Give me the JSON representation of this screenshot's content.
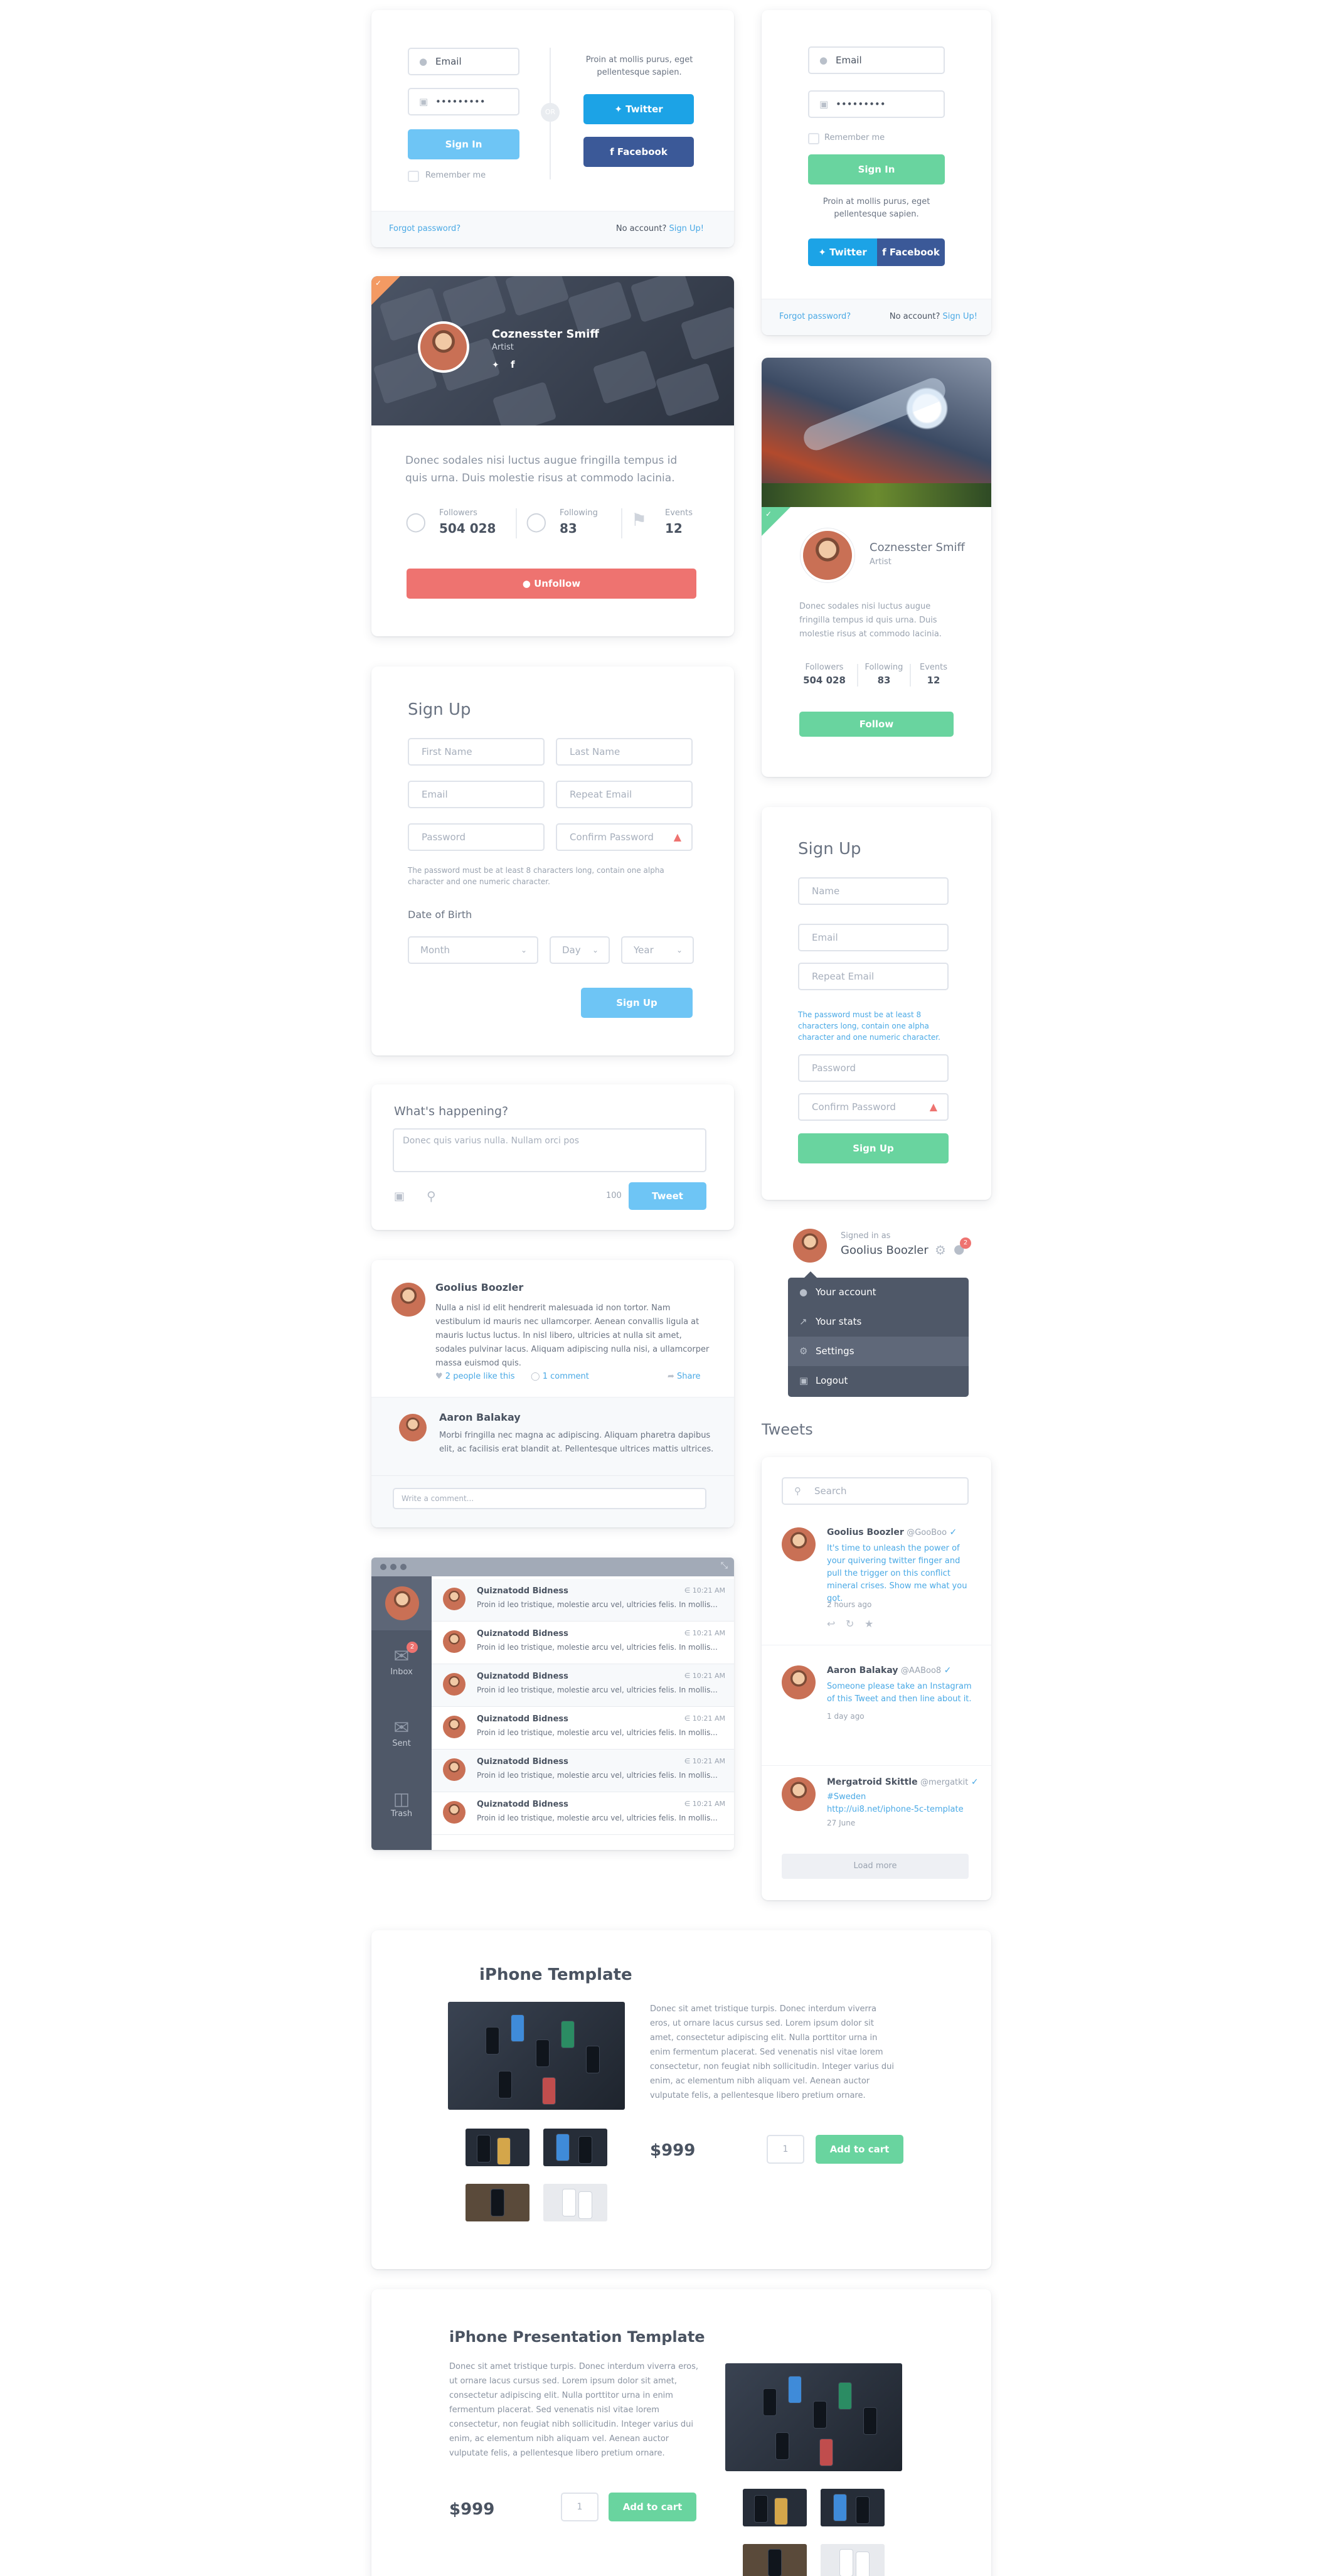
{
  "colors": {
    "accent_blue": "#6ec5f5",
    "accent_green": "#69d49f",
    "danger": "#ee7370",
    "twitter": "#1ca3e6",
    "facebook": "#3b5998",
    "dark_panel": "#4f5868"
  },
  "login1": {
    "email": "Email",
    "password": "•••••••••",
    "sign_in": "Sign In",
    "remember": "Remember me",
    "or": "OR",
    "promo": "Proin at mollis purus, eget pellentesque sapien.",
    "twitter": "Twitter",
    "facebook": "Facebook",
    "forgot": "Forgot password?",
    "no_account": "No account?",
    "sign_up": "Sign Up!"
  },
  "login2": {
    "email": "Email",
    "password": "•••••••••",
    "remember": "Remember me",
    "sign_in": "Sign In",
    "promo": "Proin at mollis purus, eget pellentesque sapien.",
    "twitter": "Twitter",
    "facebook": "Facebook",
    "forgot": "Forgot password?",
    "no_account": "No account?",
    "sign_up": "Sign Up!"
  },
  "profile1": {
    "name": "Coznesster Smiff",
    "role": "Artist",
    "bio": "Donec sodales nisi luctus augue fringilla tempus id quis urna. Duis molestie risus at commodo lacinia.",
    "stats": [
      {
        "label": "Followers",
        "value": "504 028"
      },
      {
        "label": "Following",
        "value": "83"
      },
      {
        "label": "Events",
        "value": "12"
      }
    ],
    "button": "Unfollow"
  },
  "profile2": {
    "name": "Coznesster Smiff",
    "role": "Artist",
    "bio": "Donec sodales nisi luctus augue fringilla tempus id quis urna. Duis molestie risus at commodo lacinia.",
    "stats": [
      {
        "label": "Followers",
        "value": "504 028"
      },
      {
        "label": "Following",
        "value": "83"
      },
      {
        "label": "Events",
        "value": "12"
      }
    ],
    "button": "Follow"
  },
  "signup1": {
    "title": "Sign Up",
    "first": "First Name",
    "last": "Last Name",
    "email": "Email",
    "repeat_email": "Repeat Email",
    "password": "Password",
    "confirm": "Confirm Password",
    "hint": "The password must be at least 8 characters long, contain one alpha character and one numeric character.",
    "dob": "Date of Birth",
    "month": "Month",
    "day": "Day",
    "year": "Year",
    "button": "Sign Up"
  },
  "signup2": {
    "title": "Sign Up",
    "name": "Name",
    "email": "Email",
    "repeat_email": "Repeat Email",
    "hint": "The password must be at least 8 characters long, contain one alpha character and one numeric character.",
    "password": "Password",
    "confirm": "Confirm Password",
    "button": "Sign Up"
  },
  "compose": {
    "title": "What's happening?",
    "placeholder": "Donec quis varius nulla. Nullam orci pos",
    "count": "100",
    "button": "Tweet"
  },
  "comments": {
    "main": {
      "name": "Goolius Boozler",
      "text": "Nulla a nisl id elit hendrerit malesuada id non tortor. Nam vestibulum id mauris nec ullamcorper. Aenean convallis ligula at mauris luctus luctus. In nisl libero, ultricies at nulla sit amet, sodales pulvinar lacus. Aliquam adipiscing nulla nisi, a ullamcorper massa euismod quis.",
      "likes": "2 people like this",
      "comments": "1 comment",
      "share": "Share"
    },
    "reply": {
      "name": "Aaron Balakay",
      "text": "Morbi fringilla nec magna ac adipiscing. Aliquam pharetra dapibus elit, ac facilisis erat blandit at. Pellentesque ultrices mattis ultrices."
    },
    "placeholder": "Write a comment..."
  },
  "mail": {
    "sidebar": [
      {
        "label": "Inbox",
        "badge": "2"
      },
      {
        "label": "Sent"
      },
      {
        "label": "Trash"
      }
    ],
    "rows": [
      {
        "sender": "Quiznatodd Bidness",
        "time": "10:21 AM",
        "preview": "Proin id leo tristique, molestie arcu vel, ultricies felis. In mollis..."
      },
      {
        "sender": "Quiznatodd Bidness",
        "time": "10:21 AM",
        "preview": "Proin id leo tristique, molestie arcu vel, ultricies felis. In mollis..."
      },
      {
        "sender": "Quiznatodd Bidness",
        "time": "10:21 AM",
        "preview": "Proin id leo tristique, molestie arcu vel, ultricies felis. In mollis..."
      },
      {
        "sender": "Quiznatodd Bidness",
        "time": "10:21 AM",
        "preview": "Proin id leo tristique, molestie arcu vel, ultricies felis. In mollis..."
      },
      {
        "sender": "Quiznatodd Bidness",
        "time": "10:21 AM",
        "preview": "Proin id leo tristique, molestie arcu vel, ultricies felis. In mollis..."
      },
      {
        "sender": "Quiznatodd Bidness",
        "time": "10:21 AM",
        "preview": "Proin id leo tristique, molestie arcu vel, ultricies felis. In mollis..."
      }
    ]
  },
  "account": {
    "signed_in_as": "Signed in as",
    "name": "Goolius Boozler",
    "badge": "2",
    "menu": [
      "Your account",
      "Your stats",
      "Settings",
      "Logout"
    ]
  },
  "tweets": {
    "title": "Tweets",
    "search": "Search",
    "items": [
      {
        "name": "Goolius Boozler",
        "handle": "@GooBoo",
        "text": "It's time to unleash the power of your quivering twitter finger and pull the trigger on this conflict mineral crises. Show me what you got.",
        "time": "2 hours ago"
      },
      {
        "name": "Aaron Balakay",
        "handle": "@AABoo8",
        "text": "Someone please take an Instagram of this Tweet and then line about it.",
        "time": "1 day ago"
      },
      {
        "name": "Mergatroid Skittle",
        "handle": "@mergatkit",
        "text": "#Sweden",
        "link": "http://ui8.net/iphone-5c-template",
        "time": "27 June"
      }
    ],
    "load_more": "Load more"
  },
  "product1": {
    "title": "iPhone Template",
    "desc": "Donec sit amet tristique turpis. Donec interdum viverra eros, ut ornare lacus cursus sed. Lorem ipsum dolor sit amet, consectetur adipiscing elit. Nulla porttitor urna in enim fermentum placerat. Sed venenatis nisl vitae lorem consectetur, non feugiat nibh sollicitudin. Integer varius dui enim, ac elementum nibh aliquam vel. Aenean auctor vulputate felis, a pellentesque libero pretium ornare.",
    "price": "$999",
    "qty": "1",
    "button": "Add to cart"
  },
  "product2": {
    "title": "iPhone Presentation Template",
    "desc": "Donec sit amet tristique turpis. Donec interdum viverra eros, ut ornare lacus cursus sed. Lorem ipsum dolor sit amet, consectetur adipiscing elit. Nulla porttitor urna in enim fermentum placerat. Sed venenatis nisl vitae lorem consectetur, non feugiat nibh sollicitudin. Integer varius dui enim, ac elementum nibh aliquam vel. Aenean auctor vulputate felis, a pellentesque libero pretium ornare.",
    "price": "$999",
    "qty": "1",
    "button": "Add to cart"
  }
}
